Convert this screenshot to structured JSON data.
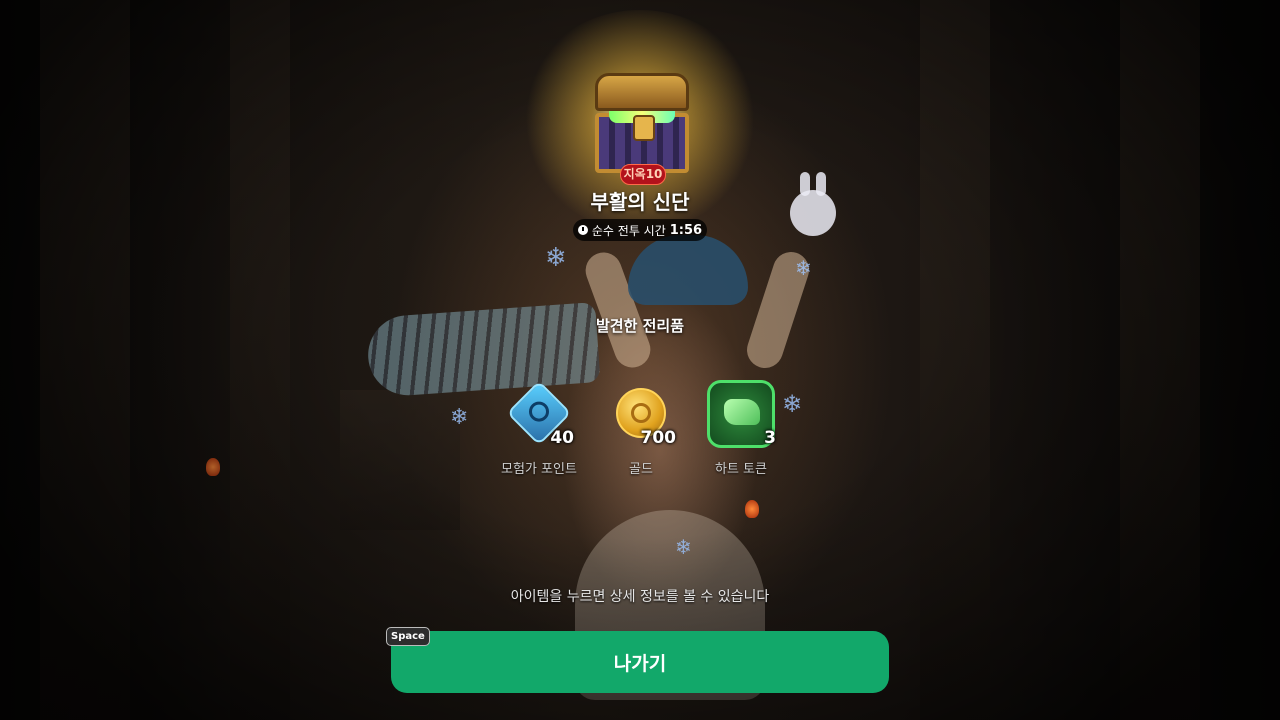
{
  "chest": {
    "badge": "지옥10"
  },
  "dungeon": {
    "name": "부활의 신단"
  },
  "timer": {
    "label": "순수 전투 시간",
    "value": "1:56"
  },
  "loot": {
    "title": "발견한 전리품",
    "items": [
      {
        "label": "모험가 포인트",
        "count": "40",
        "icon": "adventurer-point-icon",
        "color": "#4fb8e8"
      },
      {
        "label": "골드",
        "count": "700",
        "icon": "gold-coin-icon",
        "color": "#e7b23a"
      },
      {
        "label": "하트 토큰",
        "count": "3",
        "icon": "heart-token-icon",
        "color": "#3fbf55"
      }
    ]
  },
  "hint": "아이템을 누르면 상세 정보를 볼 수 있습니다",
  "exit_button": {
    "label": "나가기",
    "key_hint": "Space",
    "color": "#12a86a"
  }
}
